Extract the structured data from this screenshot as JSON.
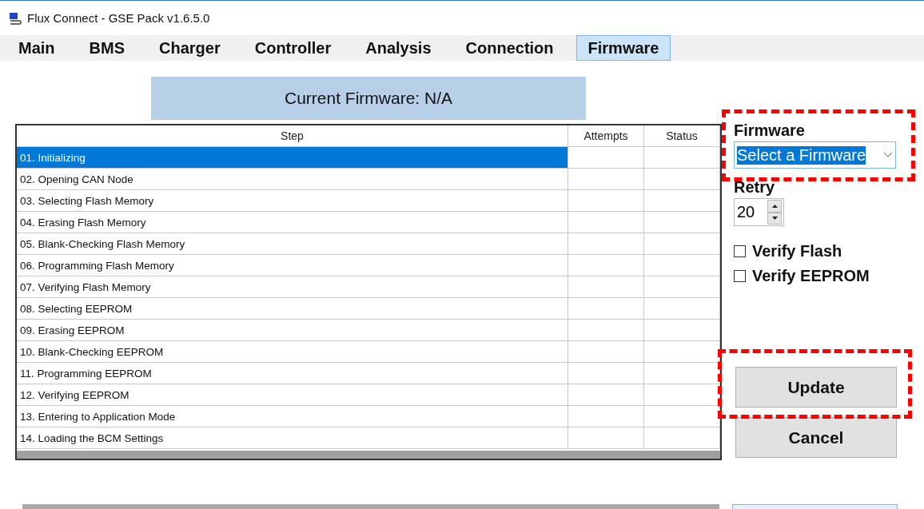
{
  "window": {
    "title": "Flux Connect - GSE Pack v1.6.5.0"
  },
  "tabs": [
    {
      "label": "Main",
      "selected": false
    },
    {
      "label": "BMS",
      "selected": false
    },
    {
      "label": "Charger",
      "selected": false
    },
    {
      "label": "Controller",
      "selected": false
    },
    {
      "label": "Analysis",
      "selected": false
    },
    {
      "label": "Connection",
      "selected": false
    },
    {
      "label": "Firmware",
      "selected": true
    }
  ],
  "current_firmware": "Current Firmware: N/A",
  "table": {
    "columns": [
      "Step",
      "Attempts",
      "Status"
    ],
    "rows": [
      {
        "step": "01. Initializing",
        "selected": true
      },
      {
        "step": "02. Opening CAN Node",
        "selected": false
      },
      {
        "step": "03. Selecting Flash Memory",
        "selected": false
      },
      {
        "step": "04. Erasing Flash Memory",
        "selected": false
      },
      {
        "step": "05. Blank-Checking Flash Memory",
        "selected": false
      },
      {
        "step": "06. Programming Flash Memory",
        "selected": false
      },
      {
        "step": "07. Verifying Flash Memory",
        "selected": false
      },
      {
        "step": "08. Selecting EEPROM",
        "selected": false
      },
      {
        "step": "09. Erasing EEPROM",
        "selected": false
      },
      {
        "step": "10. Blank-Checking EEPROM",
        "selected": false
      },
      {
        "step": "11. Programming EEPROM",
        "selected": false
      },
      {
        "step": "12. Verifying EEPROM",
        "selected": false
      },
      {
        "step": "13. Entering to Application Mode",
        "selected": false
      },
      {
        "step": "14. Loading the BCM Settings",
        "selected": false
      }
    ]
  },
  "firmware": {
    "label": "Firmware",
    "value": "Select a Firmware",
    "highlighted": true
  },
  "retry": {
    "label": "Retry",
    "value": "20"
  },
  "options": [
    {
      "label": "Verify Flash",
      "checked": false
    },
    {
      "label": "Verify EEPROM",
      "checked": false
    }
  ],
  "buttons": [
    {
      "label": "Update",
      "highlighted": true
    },
    {
      "label": "Cancel",
      "highlighted": false
    }
  ]
}
